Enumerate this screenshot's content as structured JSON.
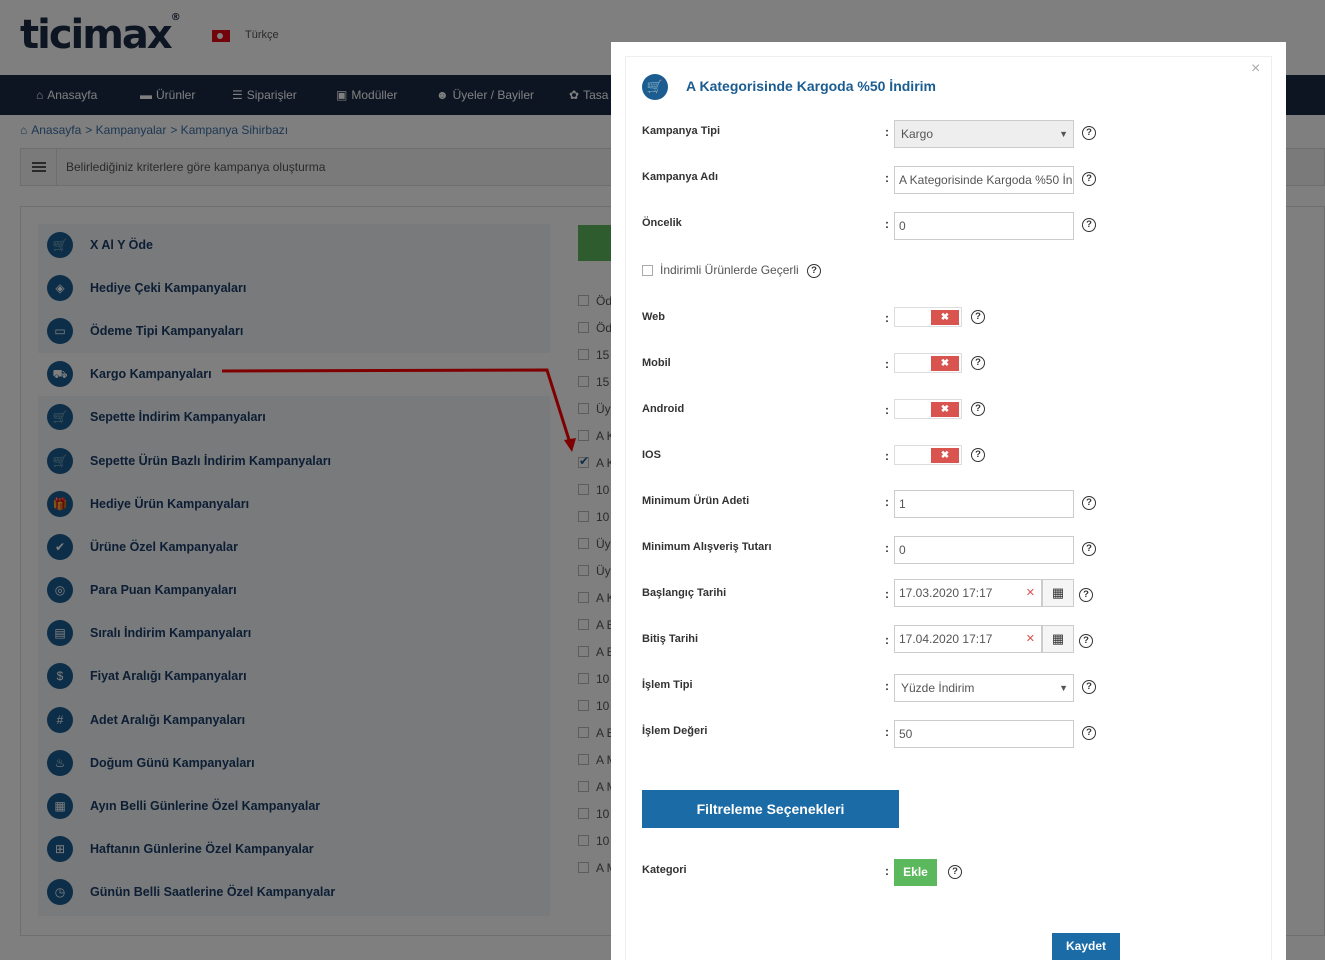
{
  "header": {
    "logo": "ticimax",
    "logo_reg": "®",
    "language": "Türkçe"
  },
  "nav": [
    {
      "label": "Anasayfa",
      "icon": "home-icon"
    },
    {
      "label": "Ürünler",
      "icon": "folder-icon"
    },
    {
      "label": "Siparişler",
      "icon": "list-icon"
    },
    {
      "label": "Modüller",
      "icon": "module-icon"
    },
    {
      "label": "Üyeler / Bayiler",
      "icon": "users-icon"
    },
    {
      "label": "Tasa",
      "icon": "palette-icon"
    }
  ],
  "breadcrumb": [
    "Anasayfa",
    "> Kampanyalar",
    "> Kampanya Sihirbazı"
  ],
  "infobar": {
    "text": "Belirlediğiniz kriterlere göre kampanya oluşturma"
  },
  "categories": [
    "X Al Y Öde",
    "Hediye Çeki Kampanyaları",
    "Ödeme Tipi Kampanyaları",
    "Kargo Kampanyaları",
    "Sepette İndirim Kampanyaları",
    "Sepette Ürün Bazlı İndirim Kampanyaları",
    "Hediye Ürün Kampanyaları",
    "Ürüne Özel Kampanyalar",
    "Para Puan Kampanyaları",
    "Sıralı İndirim Kampanyaları",
    "Fiyat Aralığı Kampanyaları",
    "Adet Aralığı Kampanyaları",
    "Doğum Günü Kampanyaları",
    "Ayın Belli Günlerine Özel Kampanyalar",
    "Haftanın Günlerine Özel Kampanyalar",
    "Günün Belli Saatlerine Özel Kampanyalar"
  ],
  "campaign_rows": [
    "Öd",
    "Öd",
    "15",
    "15",
    "Üy",
    "A K",
    "A K",
    "10",
    "10",
    "Üy",
    "Üy",
    "A K",
    "A E",
    "A E",
    "10",
    "10",
    "A E",
    "A M",
    "A M",
    "10",
    "10",
    "A M"
  ],
  "modal": {
    "title": "A Kategorisinde Kargoda %50 İndirim",
    "close": "×",
    "fields": {
      "kampanya_tipi": {
        "label": "Kampanya Tipi",
        "value": "Kargo"
      },
      "kampanya_adi": {
        "label": "Kampanya Adı",
        "value": "A Kategorisinde Kargoda %50 İndirim"
      },
      "oncelik": {
        "label": "Öncelik",
        "value": "0"
      },
      "indirimli": {
        "label": "İndirimli Ürünlerde Geçerli"
      },
      "web": {
        "label": "Web"
      },
      "mobil": {
        "label": "Mobil"
      },
      "android": {
        "label": "Android"
      },
      "ios": {
        "label": "IOS"
      },
      "min_urun": {
        "label": "Minimum Ürün Adeti",
        "value": "1"
      },
      "min_tutar": {
        "label": "Minimum Alışveriş Tutarı",
        "value": "0"
      },
      "baslangic": {
        "label": "Başlangıç Tarihi",
        "value": "17.03.2020 17:17"
      },
      "bitis": {
        "label": "Bitiş Tarihi",
        "value": "17.04.2020 17:17"
      },
      "islem_tipi": {
        "label": "İşlem Tipi",
        "value": "Yüzde İndirim"
      },
      "islem_degeri": {
        "label": "İşlem Değeri",
        "value": "50"
      },
      "kategori": {
        "label": "Kategori"
      }
    },
    "colon": ":",
    "help": "?",
    "toggle_off": "✖",
    "filter_button": "Filtreleme Seçenekleri",
    "add_button": "Ekle",
    "save_button": "Kaydet"
  },
  "colors": {
    "nav_bg": "#1b2a47",
    "accent_blue": "#1b5c91",
    "button_blue": "#1b6ba6",
    "green": "#5cb85c",
    "toggle_off_red": "#d9534f",
    "annotation_arrow": "#ff0000"
  }
}
